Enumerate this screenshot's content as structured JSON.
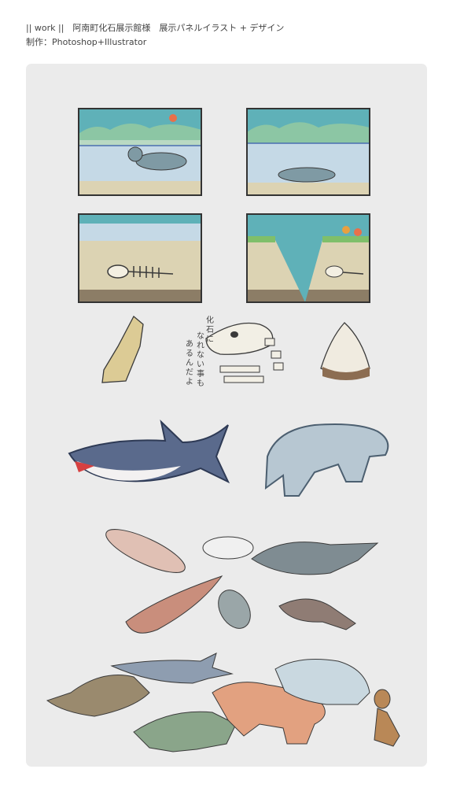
{
  "header": {
    "line1": "|| work ||　阿南町化石展示館様　展示パネルイラスト + デザイン",
    "line2": "制作：Photoshop+Illustrator"
  },
  "illustration": {
    "side_text": [
      "化",
      "石",
      "に",
      "な",
      "れ",
      "な",
      "い",
      "事",
      "も",
      "あ",
      "る",
      "ん",
      "だ",
      "よ"
    ]
  },
  "colors": {
    "panel": "#ebebeb",
    "sky": "#5fb1b8",
    "water": "#c5d9e6",
    "sand": "#dcd3b3",
    "outline": "#3a3a3a"
  }
}
